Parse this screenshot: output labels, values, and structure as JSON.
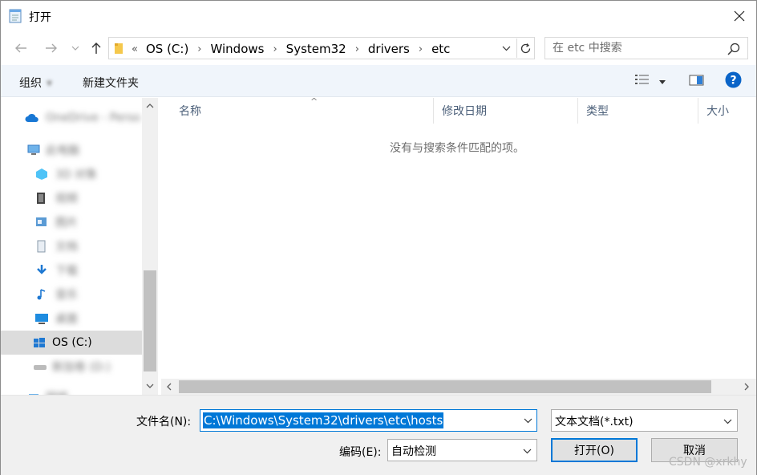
{
  "window": {
    "title": "打开"
  },
  "address": {
    "crumbs": [
      "OS (C:)",
      "Windows",
      "System32",
      "drivers",
      "etc"
    ]
  },
  "search": {
    "placeholder": "在 etc 中搜索"
  },
  "commands": {
    "organize": "组织",
    "new_folder": "新建文件夹"
  },
  "tree": {
    "items": [
      {
        "label": "OneDrive - Perso",
        "icon": "cloud-icon"
      },
      {
        "label": "此电脑",
        "icon": "computer-icon"
      },
      {
        "label": "3D 对象",
        "icon": "cube-icon"
      },
      {
        "label": "视频",
        "icon": "video-icon"
      },
      {
        "label": "图片",
        "icon": "picture-icon"
      },
      {
        "label": "文档",
        "icon": "document-icon"
      },
      {
        "label": "下载",
        "icon": "download-icon"
      },
      {
        "label": "音乐",
        "icon": "music-icon"
      },
      {
        "label": "桌面",
        "icon": "desktop-icon"
      },
      {
        "label": "OS (C:)",
        "icon": "windows-drive-icon"
      },
      {
        "label": "新加卷 (D:)",
        "icon": "drive-icon"
      },
      {
        "label": "网络",
        "icon": "network-icon"
      }
    ]
  },
  "columns": [
    "名称",
    "修改日期",
    "类型",
    "大小"
  ],
  "empty_message": "没有与搜索条件匹配的项。",
  "bottom": {
    "filename_label": "文件名(N):",
    "filename_value": "C:\\Windows\\System32\\drivers\\etc\\hosts",
    "filetype_value": "文本文档(*.txt)",
    "encoding_label": "编码(E):",
    "encoding_value": "自动检测",
    "open_button": "打开(O)",
    "cancel_button": "取消"
  },
  "watermark": "CSDN @xrkhy",
  "colors": {
    "accent": "#0078d7",
    "help": "#0a64c8",
    "column_text": "#4c607a"
  }
}
